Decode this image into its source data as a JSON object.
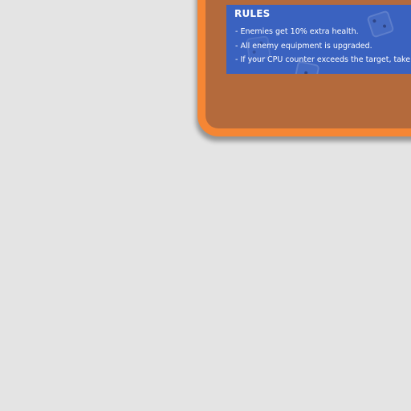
{
  "rules": {
    "title": "RULES",
    "items": [
      {
        "text": "Enemies get 10% extra health."
      },
      {
        "text": "All enemy equipment is upgraded."
      },
      {
        "text": "If your CPU counter exceeds the target, take"
      }
    ],
    "trailing_icon": "heart-icon"
  },
  "colors": {
    "background": "#e4e4e4",
    "card_border": "#f58634",
    "card_fill": "#b46a3c",
    "panel": "#3a62c0",
    "heart": "#ff6a7a"
  }
}
